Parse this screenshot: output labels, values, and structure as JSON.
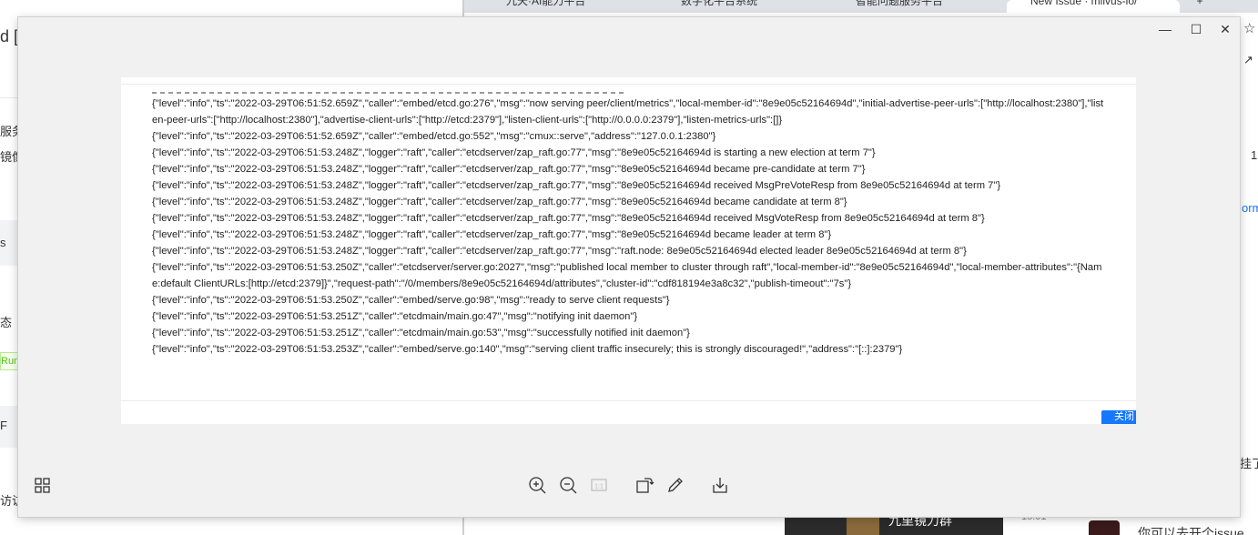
{
  "background_left": {
    "title_fragment": "d [",
    "items": [
      "服务",
      "镜像",
      "s",
      "态",
      "Runn",
      "F",
      "访访"
    ]
  },
  "background_right": {
    "tabs": [
      {
        "label": "九天·AI能力平台"
      },
      {
        "label": "数字化平台系统"
      },
      {
        "label": "智能问题服务平台"
      },
      {
        "label": "New Issue · milvus-io/"
      }
    ],
    "new_tab_symbol": "+",
    "frag_1": "1",
    "frag_link": "orm",
    "frag_hang": "挂了",
    "chat_title": "九里镜力群",
    "chat_time": "15:01",
    "chat_message": "你可以去开个issue"
  },
  "viewer": {
    "window_controls": {
      "minimize": "—",
      "maximize": "☐",
      "close": "✕"
    },
    "log_lines": [
      "{\"level\":\"info\",\"ts\":\"2022-03-29T06:51:52.659Z\",\"caller\":\"embed/etcd.go:276\",\"msg\":\"now serving peer/client/metrics\",\"local-member-id\":\"8e9e05c52164694d\",\"initial-advertise-peer-urls\":[\"http://localhost:2380\"],\"listen-peer-urls\":[\"http://localhost:2380\"],\"advertise-client-urls\":[\"http://etcd:2379\"],\"listen-client-urls\":[\"http://0.0.0.0:2379\"],\"listen-metrics-urls\":[]}",
      "{\"level\":\"info\",\"ts\":\"2022-03-29T06:51:52.659Z\",\"caller\":\"embed/etcd.go:552\",\"msg\":\"cmux::serve\",\"address\":\"127.0.0.1:2380\"}",
      "{\"level\":\"info\",\"ts\":\"2022-03-29T06:51:53.248Z\",\"logger\":\"raft\",\"caller\":\"etcdserver/zap_raft.go:77\",\"msg\":\"8e9e05c52164694d is starting a new election at term 7\"}",
      "{\"level\":\"info\",\"ts\":\"2022-03-29T06:51:53.248Z\",\"logger\":\"raft\",\"caller\":\"etcdserver/zap_raft.go:77\",\"msg\":\"8e9e05c52164694d became pre-candidate at term 7\"}",
      "{\"level\":\"info\",\"ts\":\"2022-03-29T06:51:53.248Z\",\"logger\":\"raft\",\"caller\":\"etcdserver/zap_raft.go:77\",\"msg\":\"8e9e05c52164694d received MsgPreVoteResp from 8e9e05c52164694d at term 7\"}",
      "{\"level\":\"info\",\"ts\":\"2022-03-29T06:51:53.248Z\",\"logger\":\"raft\",\"caller\":\"etcdserver/zap_raft.go:77\",\"msg\":\"8e9e05c52164694d became candidate at term 8\"}",
      "{\"level\":\"info\",\"ts\":\"2022-03-29T06:51:53.248Z\",\"logger\":\"raft\",\"caller\":\"etcdserver/zap_raft.go:77\",\"msg\":\"8e9e05c52164694d received MsgVoteResp from 8e9e05c52164694d at term 8\"}",
      "{\"level\":\"info\",\"ts\":\"2022-03-29T06:51:53.248Z\",\"logger\":\"raft\",\"caller\":\"etcdserver/zap_raft.go:77\",\"msg\":\"8e9e05c52164694d became leader at term 8\"}",
      "{\"level\":\"info\",\"ts\":\"2022-03-29T06:51:53.248Z\",\"logger\":\"raft\",\"caller\":\"etcdserver/zap_raft.go:77\",\"msg\":\"raft.node: 8e9e05c52164694d elected leader 8e9e05c52164694d at term 8\"}",
      "{\"level\":\"info\",\"ts\":\"2022-03-29T06:51:53.250Z\",\"caller\":\"etcdserver/server.go:2027\",\"msg\":\"published local member to cluster through raft\",\"local-member-id\":\"8e9e05c52164694d\",\"local-member-attributes\":\"{Name:default ClientURLs:[http://etcd:2379]}\",\"request-path\":\"/0/members/8e9e05c52164694d/attributes\",\"cluster-id\":\"cdf818194e3a8c32\",\"publish-timeout\":\"7s\"}",
      "{\"level\":\"info\",\"ts\":\"2022-03-29T06:51:53.250Z\",\"caller\":\"embed/serve.go:98\",\"msg\":\"ready to serve client requests\"}",
      "{\"level\":\"info\",\"ts\":\"2022-03-29T06:51:53.251Z\",\"caller\":\"etcdmain/main.go:47\",\"msg\":\"notifying init daemon\"}",
      "{\"level\":\"info\",\"ts\":\"2022-03-29T06:51:53.251Z\",\"caller\":\"etcdmain/main.go:53\",\"msg\":\"successfully notified init daemon\"}",
      "{\"level\":\"info\",\"ts\":\"2022-03-29T06:51:53.253Z\",\"caller\":\"embed/serve.go:140\",\"msg\":\"serving client traffic insecurely; this is strongly discouraged!\",\"address\":\"[::]:2379\"}"
    ],
    "close_button_fragment": "关闭",
    "tools": [
      {
        "name": "grid-view-icon"
      },
      {
        "name": "zoom-in-icon"
      },
      {
        "name": "zoom-out-icon"
      },
      {
        "name": "actual-size-icon",
        "label": "1:1"
      },
      {
        "name": "rotate-icon"
      },
      {
        "name": "edit-icon"
      },
      {
        "name": "download-icon"
      }
    ],
    "colors": {
      "viewer_bg": "#f1f1f1",
      "accent": "#1677ff"
    }
  }
}
